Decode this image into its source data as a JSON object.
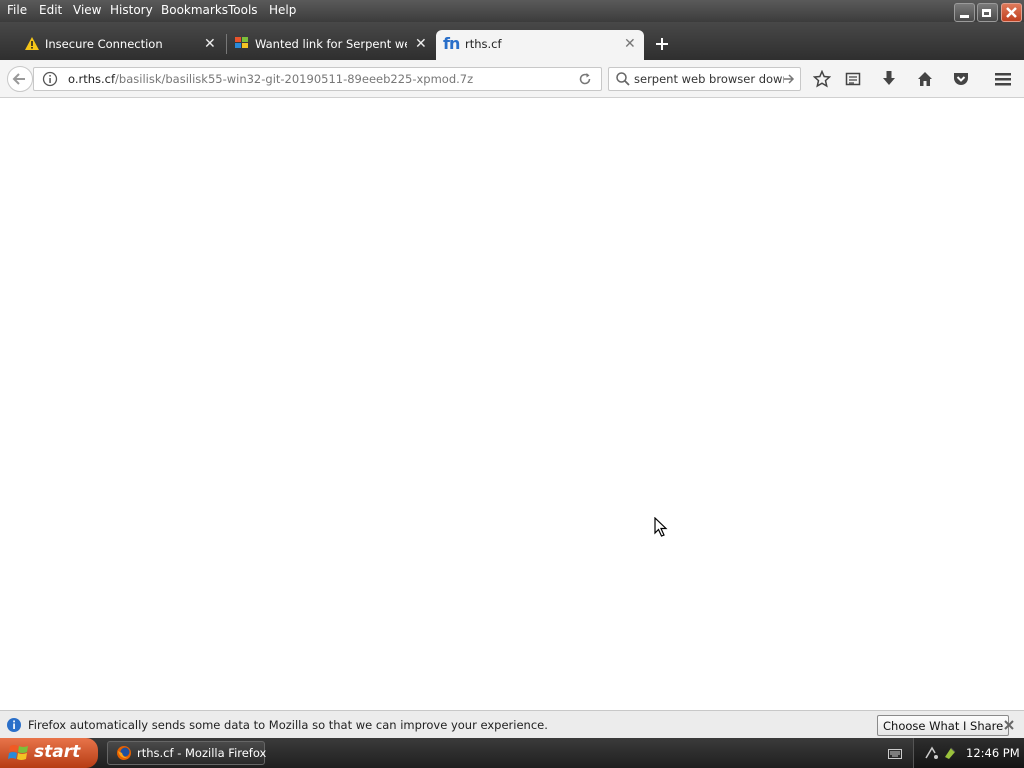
{
  "menu": {
    "items": [
      "File",
      "Edit",
      "View",
      "History",
      "Bookmarks",
      "Tools",
      "Help"
    ]
  },
  "tabs": [
    {
      "label": "Insecure Connection",
      "icon": "warning-icon",
      "active": false
    },
    {
      "label": "Wanted link for Serpent web ...",
      "icon": "msfn-favicon",
      "active": false
    },
    {
      "label": "rths.cf",
      "icon": "fn-favicon",
      "active": true
    }
  ],
  "navbar": {
    "url_host": "o.rths.cf",
    "url_path": "/basilisk/basilisk55-win32-git-20190511-89eeeb225-xpmod.7z",
    "search_value": "serpent web browser downloac"
  },
  "notification": {
    "message": "Firefox automatically sends some data to Mozilla so that we can improve your experience.",
    "button_label": "Choose What I Share"
  },
  "taskbar": {
    "start_label": "start",
    "task_label": "rths.cf - Mozilla Firefox",
    "clock": "12:46 PM"
  },
  "colors": {
    "chrome_dark": "#3c3c3c",
    "toolbar_bg": "#f4f4f4",
    "start_orange": "#d2582a",
    "info_blue": "#2a6fc9"
  }
}
